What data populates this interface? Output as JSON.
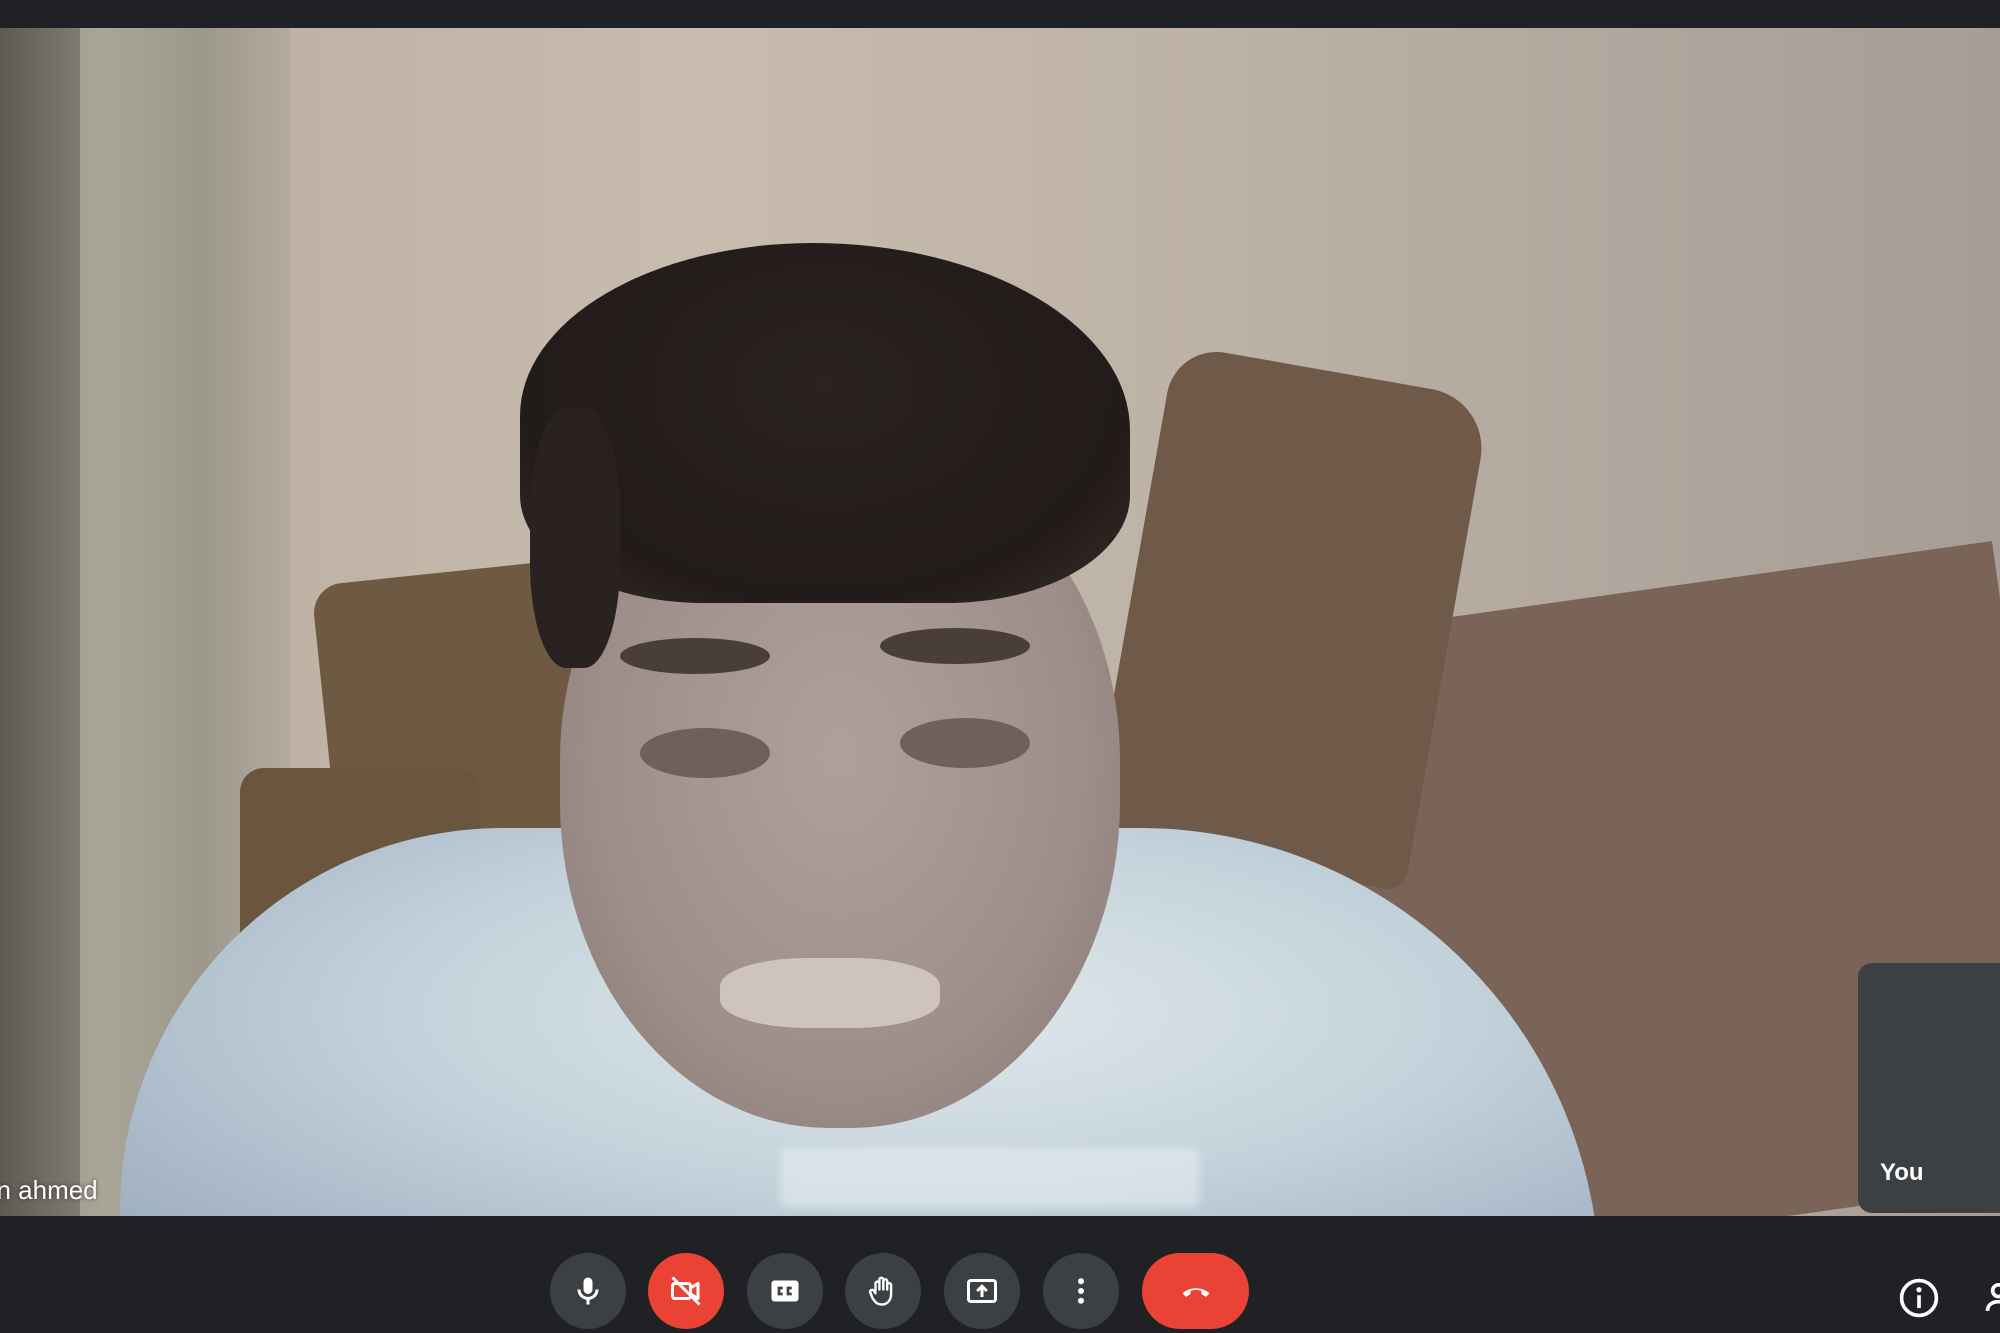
{
  "participant": {
    "name": "en ahmed"
  },
  "self_view": {
    "label": "You"
  },
  "controls": {
    "microphone": {
      "icon": "microphone-icon",
      "state": "on"
    },
    "camera": {
      "icon": "camera-off-icon",
      "state": "off",
      "color": "#ea4335"
    },
    "captions": {
      "icon": "captions-icon"
    },
    "raise_hand": {
      "icon": "hand-icon"
    },
    "present": {
      "icon": "present-screen-icon"
    },
    "more_options": {
      "icon": "more-vert-icon"
    },
    "leave_call": {
      "icon": "end-call-icon",
      "color": "#ea4335"
    },
    "meeting_details": {
      "icon": "info-icon"
    },
    "people": {
      "icon": "people-icon"
    }
  },
  "colors": {
    "background": "#202124",
    "button": "#3c4043",
    "danger": "#ea4335"
  }
}
